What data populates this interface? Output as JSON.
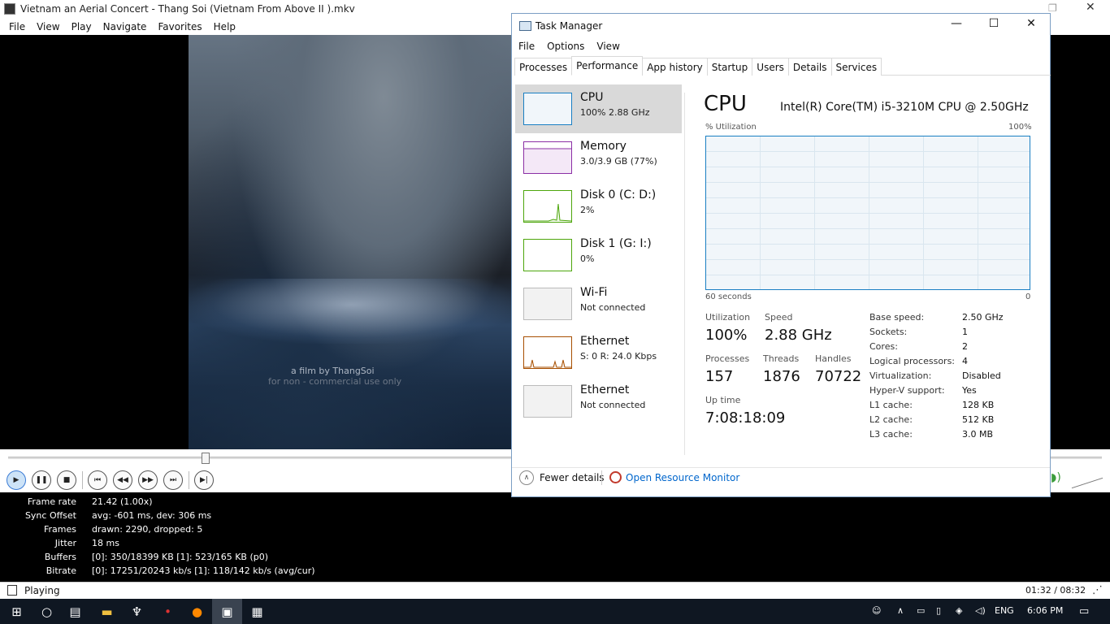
{
  "mpc": {
    "title": "Vietnam an Aerial Concert - Thang Soi (Vietnam From Above II ).mkv",
    "menu": [
      "File",
      "View",
      "Play",
      "Navigate",
      "Favorites",
      "Help"
    ],
    "video_credit": "a film by ThangSoi",
    "video_credit_sub": "for non - commercial use only",
    "stats": [
      {
        "label": "Frame rate",
        "value": "21.42 (1.00x)"
      },
      {
        "label": "Sync Offset",
        "value": "avg: -601 ms, dev: 306 ms"
      },
      {
        "label": "Frames",
        "value": "drawn: 2290, dropped: 5"
      },
      {
        "label": "Jitter",
        "value": "18 ms"
      },
      {
        "label": "Buffers",
        "value": "[0]: 350/18399 KB [1]: 523/165 KB (p0)"
      },
      {
        "label": "Bitrate",
        "value": "[0]: 17251/20243 kb/s [1]: 118/142 kb/s (avg/cur)"
      }
    ],
    "status": "Playing",
    "time": "01:32 / 08:32",
    "progress_fraction": 0.18
  },
  "taskmanager": {
    "title": "Task Manager",
    "menu": [
      "File",
      "Options",
      "View"
    ],
    "tabs": [
      "Processes",
      "Performance",
      "App history",
      "Startup",
      "Users",
      "Details",
      "Services"
    ],
    "active_tab": "Performance",
    "resources": [
      {
        "name": "CPU",
        "sub": "100%  2.88 GHz",
        "color": "#1a7fc3"
      },
      {
        "name": "Memory",
        "sub": "3.0/3.9 GB (77%)",
        "color": "#8b2fa5"
      },
      {
        "name": "Disk 0 (C: D:)",
        "sub": "2%",
        "color": "#4da60c"
      },
      {
        "name": "Disk 1 (G: I:)",
        "sub": "0%",
        "color": "#4da60c"
      },
      {
        "name": "Wi-Fi",
        "sub": "Not connected",
        "color": "#aaaaaa"
      },
      {
        "name": "Ethernet",
        "sub": "S: 0  R: 24.0 Kbps",
        "color": "#a74f01"
      },
      {
        "name": "Ethernet",
        "sub": "Not connected",
        "color": "#aaaaaa"
      }
    ],
    "cpu": {
      "header": "CPU",
      "model": "Intel(R) Core(TM) i5-3210M CPU @ 2.50GHz",
      "util_label": "% Utilization",
      "util_max": "100%",
      "graph_left": "60 seconds",
      "graph_right": "0",
      "utilization_label": "Utilization",
      "utilization": "100%",
      "speed_label": "Speed",
      "speed": "2.88 GHz",
      "processes_label": "Processes",
      "processes": "157",
      "threads_label": "Threads",
      "threads": "1876",
      "handles_label": "Handles",
      "handles": "70722",
      "uptime_label": "Up time",
      "uptime": "7:08:18:09",
      "details": [
        {
          "k": "Base speed:",
          "v": "2.50 GHz"
        },
        {
          "k": "Sockets:",
          "v": "1"
        },
        {
          "k": "Cores:",
          "v": "2"
        },
        {
          "k": "Logical processors:",
          "v": "4"
        },
        {
          "k": "Virtualization:",
          "v": "Disabled"
        },
        {
          "k": "Hyper-V support:",
          "v": "Yes"
        },
        {
          "k": "L1 cache:",
          "v": "128 KB"
        },
        {
          "k": "L2 cache:",
          "v": "512 KB"
        },
        {
          "k": "L3 cache:",
          "v": "3.0 MB"
        }
      ]
    },
    "fewer_details": "Fewer details",
    "open_resource_monitor": "Open Resource Monitor"
  },
  "taskbar": {
    "language": "ENG",
    "clock": "6:06 PM"
  }
}
